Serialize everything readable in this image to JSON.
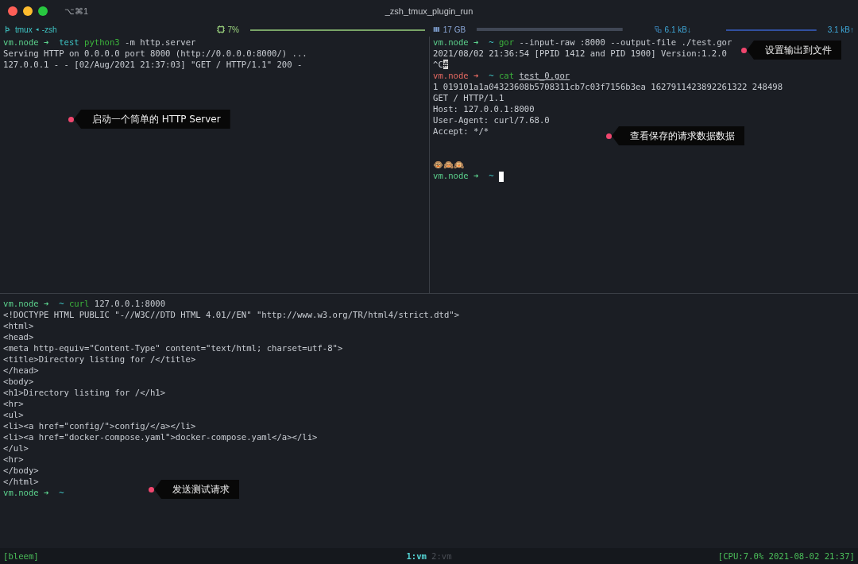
{
  "window": {
    "shortcut": "⌥⌘1",
    "title": "_zsh_tmux_plugin_run"
  },
  "status_line": {
    "session": "tmux",
    "separator": "◂",
    "shell": "-zsh",
    "cpu": "7%",
    "memory": "17 GB",
    "download": "6.1 kB↓",
    "upload": "3.1 kB↑"
  },
  "panes": [
    {
      "lines": [
        [
          {
            "kind": "prompt",
            "text": "vm.node ➜ "
          },
          {
            "kind": "dir",
            "text": " test "
          },
          {
            "kind": "cmd",
            "text": "python3"
          },
          {
            "kind": "text",
            "text": " -m http.server"
          }
        ],
        [
          {
            "kind": "text",
            "text": "Serving HTTP on 0.0.0.0 port 8000 (http://0.0.0.0:8000/) ..."
          }
        ],
        [
          {
            "kind": "text",
            "text": "127.0.0.1 - - [02/Aug/2021 21:37:03] \"GET / HTTP/1.1\" 200 -"
          }
        ]
      ],
      "annotations": [
        {
          "text": "启动一个简单的 HTTP Server"
        }
      ]
    },
    {
      "lines": [
        [
          {
            "kind": "prompt",
            "text": "vm.node ➜ "
          },
          {
            "kind": "dir",
            "text": " ~ "
          },
          {
            "kind": "cmd",
            "text": "gor"
          },
          {
            "kind": "text",
            "text": " --input-raw :8000 --output-file ./test.gor"
          }
        ],
        [
          {
            "kind": "text",
            "text": "2021/08/02 21:36:54 [PPID 1412 and PID 1900] Version:1.2.0"
          }
        ],
        [
          {
            "kind": "text",
            "text": "^C"
          },
          {
            "kind": "highlight",
            "text": "#"
          }
        ],
        [
          {
            "kind": "prompt_error",
            "text": "vm.node ➜ "
          },
          {
            "kind": "dir",
            "text": " ~ "
          },
          {
            "kind": "cmd",
            "text": "cat "
          },
          {
            "kind": "path",
            "text": "test_0.gor"
          }
        ],
        [
          {
            "kind": "text",
            "text": "1 019101a1a04323608b5708311cb7c03f7156b3ea 1627911423892261322 248498"
          }
        ],
        [
          {
            "kind": "text",
            "text": "GET / HTTP/1.1"
          }
        ],
        [
          {
            "kind": "text",
            "text": "Host: 127.0.0.1:8000"
          }
        ],
        [
          {
            "kind": "text",
            "text": "User-Agent: curl/7.68.0"
          }
        ],
        [
          {
            "kind": "text",
            "text": "Accept: */*"
          }
        ],
        [
          {
            "kind": "decoration",
            "text": "🐵🙈🙉"
          }
        ],
        [
          {
            "kind": "prompt",
            "text": "vm.node ➜ "
          },
          {
            "kind": "dir",
            "text": " ~ "
          },
          {
            "kind": "cursor"
          }
        ]
      ],
      "annotations": [
        {
          "text": "设置输出到文件"
        },
        {
          "text": "查看保存的请求数据数据"
        }
      ]
    },
    {
      "lines": [
        [
          {
            "kind": "prompt",
            "text": "vm.node ➜ "
          },
          {
            "kind": "dir",
            "text": " ~ "
          },
          {
            "kind": "cmd",
            "text": "curl"
          },
          {
            "kind": "text",
            "text": " 127.0.0.1:8000"
          }
        ],
        [
          {
            "kind": "text",
            "text": "<!DOCTYPE HTML PUBLIC \"-//W3C//DTD HTML 4.01//EN\" \"http://www.w3.org/TR/html4/strict.dtd\">"
          }
        ],
        [
          {
            "kind": "text",
            "text": "<html>"
          }
        ],
        [
          {
            "kind": "text",
            "text": "<head>"
          }
        ],
        [
          {
            "kind": "text",
            "text": "<meta http-equiv=\"Content-Type\" content=\"text/html; charset=utf-8\">"
          }
        ],
        [
          {
            "kind": "text",
            "text": "<title>Directory listing for /</title>"
          }
        ],
        [
          {
            "kind": "text",
            "text": "</head>"
          }
        ],
        [
          {
            "kind": "text",
            "text": "<body>"
          }
        ],
        [
          {
            "kind": "text",
            "text": "<h1>Directory listing for /</h1>"
          }
        ],
        [
          {
            "kind": "text",
            "text": "<hr>"
          }
        ],
        [
          {
            "kind": "text",
            "text": "<ul>"
          }
        ],
        [
          {
            "kind": "text",
            "text": "<li><a href=\"config/\">config/</a></li>"
          }
        ],
        [
          {
            "kind": "text",
            "text": "<li><a href=\"docker-compose.yaml\">docker-compose.yaml</a></li>"
          }
        ],
        [
          {
            "kind": "text",
            "text": "</ul>"
          }
        ],
        [
          {
            "kind": "text",
            "text": "<hr>"
          }
        ],
        [
          {
            "kind": "text",
            "text": "</body>"
          }
        ],
        [
          {
            "kind": "text",
            "text": "</html>"
          }
        ],
        [
          {
            "kind": "prompt",
            "text": "vm.node ➜ "
          },
          {
            "kind": "dir",
            "text": " ~"
          }
        ]
      ],
      "annotations": [
        {
          "text": "发送测试请求"
        }
      ]
    }
  ],
  "tmux_bar": {
    "session": "[bleem]",
    "windows": [
      {
        "label": "1:vm",
        "selected": true
      },
      {
        "label": "2:vm",
        "selected": false
      }
    ],
    "right": "[CPU:7.0% 2021-08-02 21:37]"
  }
}
